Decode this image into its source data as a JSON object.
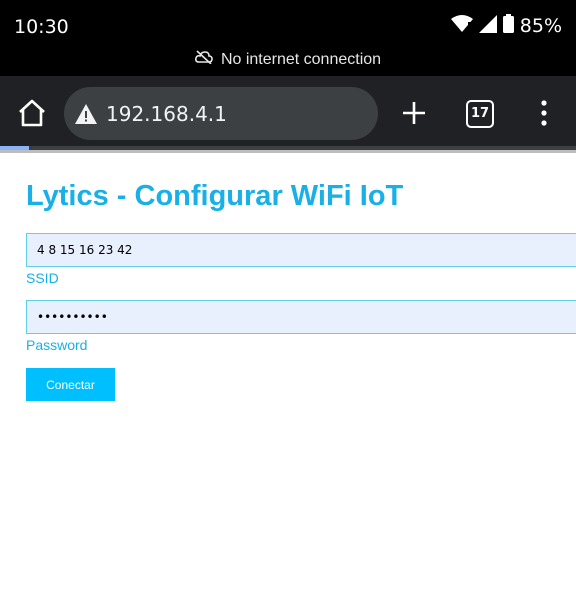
{
  "status_bar": {
    "time": "10:30",
    "battery": "85%",
    "network_message": "No internet connection",
    "icons": [
      "wifi-icon",
      "signal-icon",
      "battery-icon",
      "cloud-off-icon"
    ]
  },
  "browser": {
    "url": "192.168.4.1",
    "tab_count": "17",
    "load_progress": 0.05,
    "icons": [
      "home-icon",
      "warning-icon",
      "plus-icon",
      "tabs-icon",
      "more-vertical-icon"
    ]
  },
  "page": {
    "title": "Lytics - Configurar WiFi IoT",
    "ssid_value": "4 8 15 16 23 42",
    "ssid_label": "SSID",
    "password_value": "••••••••••",
    "password_label": "Password",
    "connect_label": "Conectar",
    "accent": "#18b0e6",
    "button_color": "#00bfff"
  }
}
